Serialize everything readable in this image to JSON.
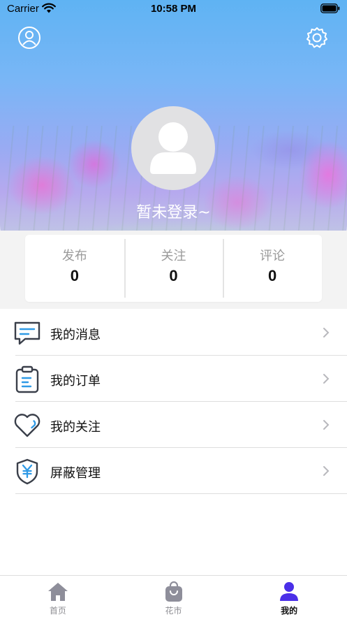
{
  "status_bar": {
    "carrier": "Carrier",
    "time": "10:58 PM"
  },
  "profile": {
    "name": "暂未登录~"
  },
  "stats": [
    {
      "label": "发布",
      "value": "0"
    },
    {
      "label": "关注",
      "value": "0"
    },
    {
      "label": "评论",
      "value": "0"
    }
  ],
  "menu": [
    {
      "label": "我的消息",
      "icon": "message-icon"
    },
    {
      "label": "我的订单",
      "icon": "clipboard-icon"
    },
    {
      "label": "我的关注",
      "icon": "heart-icon"
    },
    {
      "label": "屏蔽管理",
      "icon": "shield-yen-icon"
    }
  ],
  "tabs": [
    {
      "label": "首页",
      "icon": "home-icon",
      "active": false
    },
    {
      "label": "花市",
      "icon": "shopping-bag-icon",
      "active": false
    },
    {
      "label": "我的",
      "icon": "person-icon",
      "active": true
    }
  ],
  "colors": {
    "accent": "#4a2fe8",
    "inactive_icon": "#8e8e9a",
    "menu_icon_dark": "#3a3f4a",
    "menu_icon_accent": "#2f9ae6"
  }
}
